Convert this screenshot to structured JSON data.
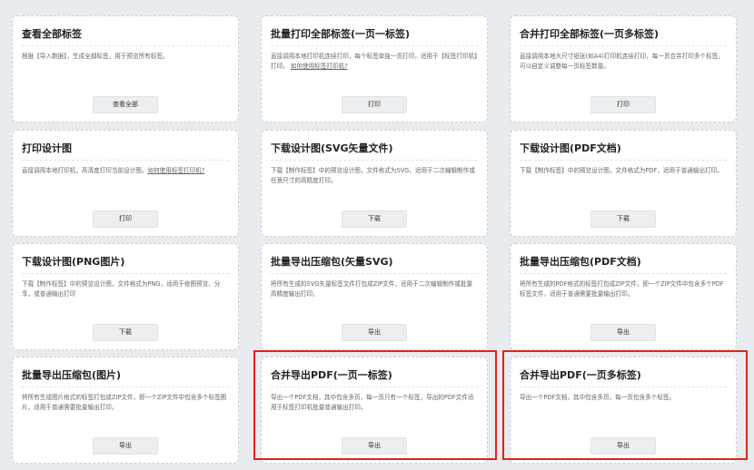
{
  "cards": [
    {
      "title": "查看全部标签",
      "desc": "根据【导入数据】，生成全部标签，用于预览所有标签。",
      "link": "",
      "desc2": "",
      "button": "查看全部"
    },
    {
      "title": "批量打印全部标签(一页一标签)",
      "desc": "直接调用本地打印机连续打印，每个标签单独一页打印。适用于【标签打印机】打印。",
      "link": "如何使用标签打印机?",
      "desc2": "",
      "button": "打印"
    },
    {
      "title": "合并打印全部标签(一页多标签)",
      "desc": "直接调用本地大尺寸纸张(如A4)打印机连续打印，每一页合并打印多个标签，可以自定义调整每一页标签数量。",
      "link": "",
      "desc2": "",
      "button": "打印"
    },
    {
      "title": "打印设计图",
      "desc": "直接调用本地打印机，高清度打印当前设计图。",
      "link": "如何使用标签打印机?",
      "desc2": "",
      "button": "打印"
    },
    {
      "title": "下载设计图(SVG矢量文件)",
      "desc": "下载【制作标签】中的预览设计图，文件格式为SVG，适用于二次编辑制作或任意尺寸的高精度打印。",
      "link": "",
      "desc2": "",
      "button": "下载"
    },
    {
      "title": "下载设计图(PDF文档)",
      "desc": "下载【制作标签】中的预览设计图，文件格式为PDF，适用于普通输出打印。",
      "link": "",
      "desc2": "",
      "button": "下载"
    },
    {
      "title": "下载设计图(PNG图片)",
      "desc": "下载【制作标签】中的预览设计图，文件格式为PNG，适用于修图预览、分享，或普通输出打印",
      "link": "",
      "desc2": "",
      "button": "下载"
    },
    {
      "title": "批量导出压缩包(矢量SVG)",
      "desc": "将所有生成的SVG矢量标签文件打包成ZIP文件，适用于二次编辑制作或批量高精度输出打印。",
      "link": "",
      "desc2": "",
      "button": "导出"
    },
    {
      "title": "批量导出压缩包(PDF文档)",
      "desc": "将所有生成的PDF格式的标签打包成ZIP文件，即一个ZIP文件中包含多个PDF标签文件，适用于普通需要批量输出打印。",
      "link": "",
      "desc2": "",
      "button": "导出"
    },
    {
      "title": "批量导出压缩包(图片)",
      "desc": "将所有生成图片格式的标签打包成ZIP文件，即一个ZIP文件中包含多个标签图片，适用于普通需要批量输出打印。",
      "link": "",
      "desc2": "",
      "button": "导出"
    },
    {
      "title": "合并导出PDF(一页一标签)",
      "desc": "导出一个PDF文档，其中包含多页，每一页只有一个标签，导出的PDF文件适用于标签打印机批量普通输出打印。",
      "link": "",
      "desc2": "",
      "button": "导出"
    },
    {
      "title": "合并导出PDF(一页多标签)",
      "desc": "导出一个PDF文档，其中包含多页，每一页包含多个标签。",
      "link": "",
      "desc2": "",
      "button": "导出"
    }
  ]
}
